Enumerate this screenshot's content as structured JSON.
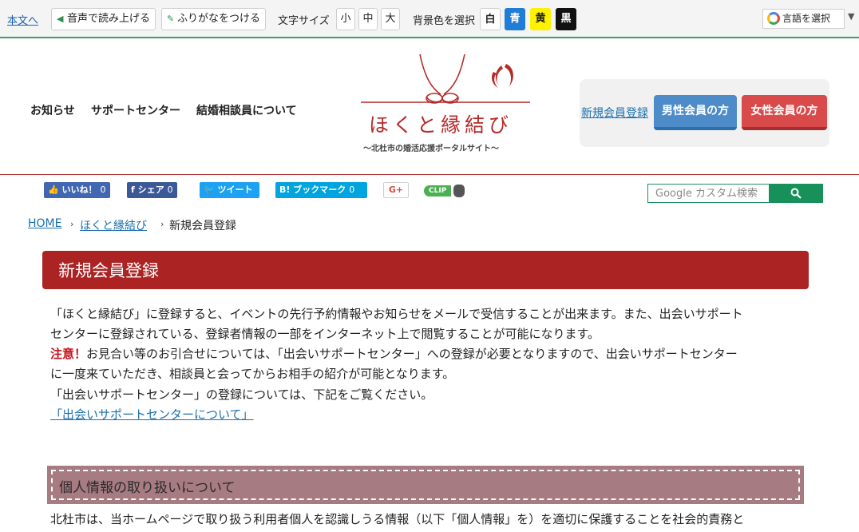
{
  "toolbar": {
    "skip_link": "本文へ",
    "read_aloud": "音声で読み上げる",
    "furigana": "ふりがなをつける",
    "font_size_label": "文字サイズ",
    "font_sizes": [
      "小",
      "中",
      "大"
    ],
    "bg_label": "背景色を選択",
    "bg_colors": [
      {
        "label": "白",
        "color": "#ffffff",
        "text": "#222222"
      },
      {
        "label": "青",
        "color": "#1f7dd6",
        "text": "#ffffff"
      },
      {
        "label": "黄",
        "color": "#fff200",
        "text": "#222222"
      },
      {
        "label": "黒",
        "color": "#111111",
        "text": "#ffffff"
      }
    ],
    "language": "言語を選択"
  },
  "header": {
    "nav": [
      "お知らせ",
      "サポートセンター",
      "結婚相談員について"
    ],
    "logo_title": "ほくと縁結び",
    "logo_subtitle": "～北杜市の婚活応援ポータルサイト～",
    "register_link": "新規会員登録",
    "register_male": "男性会員の方",
    "register_female": "女性会員の方"
  },
  "social": {
    "like": "いいね！",
    "like_count": "0",
    "share": "シェア",
    "share_count": "0",
    "tweet": "ツイート",
    "bookmark": "ブックマーク",
    "bookmark_count": "0",
    "gplus": "G+",
    "clip": "CLIP"
  },
  "search": {
    "placeholder": "Google カスタム検索"
  },
  "breadcrumb": [
    "HOME",
    "ほくと縁結び",
    "新規会員登録"
  ],
  "main": {
    "title": "新規会員登録",
    "lines": [
      "「ほくと縁結び」に登録すると、イベントの先行予約情報やお知らせをメールで受信することが出来ます。また、出会いサポート",
      "センターに登録されている、登録者情報の一部をインターネット上で閲覧することが可能になります。"
    ],
    "warning_label": "注意！",
    "warning_line1": "お見合い等のお引合せについては、「出会いサポートセンター」への登録が必要となりますので、出会いサポートセンター",
    "warning_line2": "に一度来ていただき、相談員と会ってからお相手の紹介が可能となります。",
    "support_line": "「出会いサポートセンター」の登録については、下記をご覧ください。",
    "support_link": "「出会いサポートセンターについて」",
    "section_title": "個人情報の取り扱いについて",
    "section_text": "北杜市は、当ホームページで取り扱う利用者個人を認識しうる情報（以下「個人情報」を）を適切に保護することを社会的責務と"
  },
  "colors": {
    "accent": "#ab2323",
    "link": "#1a6fae",
    "male": "#4d8cc8",
    "female": "#d94b4b",
    "section": "#a77b82"
  }
}
